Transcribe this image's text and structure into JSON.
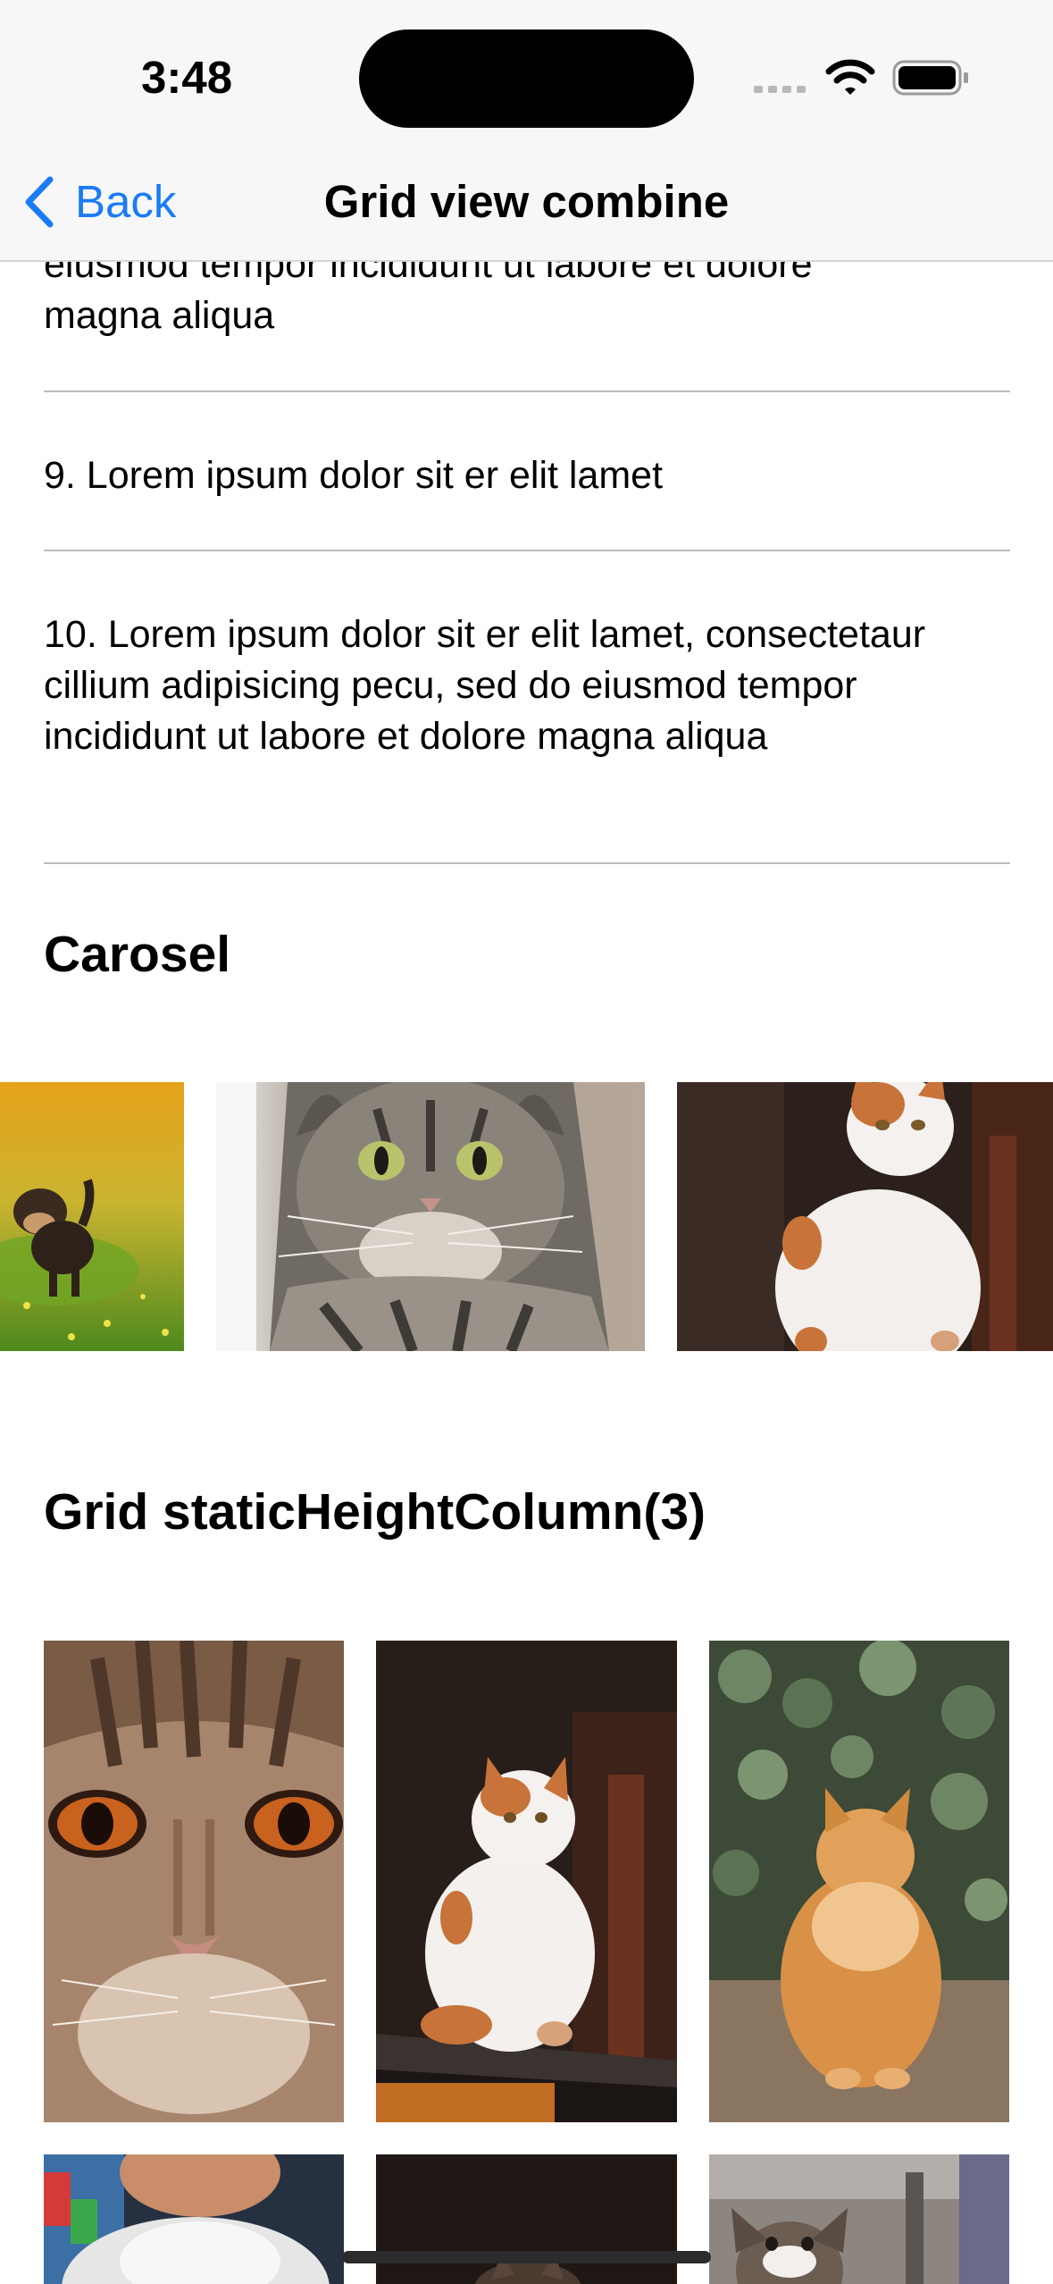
{
  "status_bar": {
    "time": "3:48"
  },
  "nav": {
    "back_label": "Back",
    "title": "Grid view combine"
  },
  "list": {
    "partial_item_line1": "eiusmod tempor incididunt ut labore et dolore",
    "partial_item_line2": "magna aliqua",
    "item_9": "9. Lorem ipsum dolor sit er elit lamet",
    "item_10": "10. Lorem ipsum dolor sit er elit lamet, consectetaur cillium adipisicing pecu, sed do eiusmod tempor incididunt ut labore et dolore magna aliqua"
  },
  "carousel": {
    "title": "Carosel",
    "items": [
      "dog-photo",
      "tabby-cat-photo",
      "calico-cat-photo"
    ]
  },
  "grid": {
    "title": "Grid staticHeightColumn(3)",
    "cells": [
      "cat-face-closeup-photo",
      "calico-cat-sitting-photo",
      "orange-cat-plants-photo",
      "white-cat-photo",
      "dark-cat-photo",
      "kitten-photo"
    ]
  },
  "colors": {
    "accent": "#1A7CF5",
    "divider": "#BDBDC0",
    "navbar_bg": "#F7F7F7"
  }
}
